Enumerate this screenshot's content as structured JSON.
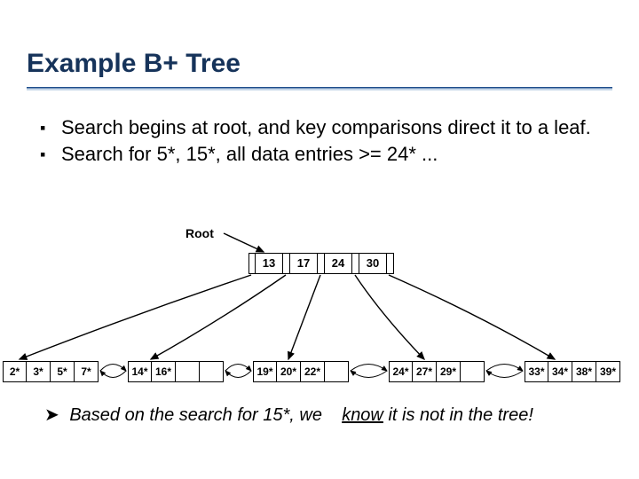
{
  "title": "Example B+ Tree",
  "bullets": [
    "Search begins at root, and key comparisons direct it to a leaf.",
    "Search for 5*, 15*, all data entries >= 24* ..."
  ],
  "root_label": "Root",
  "internal_keys": [
    "13",
    "17",
    "24",
    "30"
  ],
  "leaves": [
    [
      "2*",
      "3*",
      "5*",
      "7*"
    ],
    [
      "14*",
      "16*",
      "",
      ""
    ],
    [
      "19*",
      "20*",
      "22*",
      ""
    ],
    [
      "24*",
      "27*",
      "29*",
      ""
    ],
    [
      "33*",
      "34*",
      "38*",
      "39*"
    ]
  ],
  "footnote_prefix": "Based on the search for 15*, we ",
  "footnote_underlined": "know",
  "footnote_suffix": " it is not in the tree!"
}
